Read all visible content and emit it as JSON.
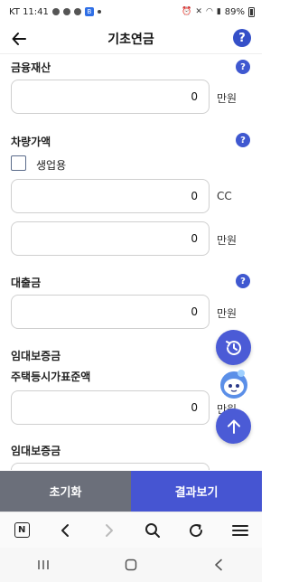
{
  "status_bar": {
    "carrier_time": "KT 11:41",
    "battery": "89%"
  },
  "header": {
    "title": "기초연금"
  },
  "form": {
    "financial_assets": {
      "label": "금융재산",
      "value": "0",
      "unit": "만원"
    },
    "vehicle": {
      "label": "차량가액",
      "business_use_label": "생업용",
      "business_use_checked": false,
      "displacement": {
        "value": "0",
        "unit": "CC"
      },
      "price": {
        "value": "0",
        "unit": "만원"
      }
    },
    "loan": {
      "label": "대출금",
      "value": "0",
      "unit": "만원"
    },
    "lease_deposit_1": {
      "label": "임대보증금",
      "sublabel": "주택등시가표준액",
      "value": "0",
      "unit": "만원"
    },
    "lease_deposit_2": {
      "label": "임대보증금"
    }
  },
  "help_symbol": "?",
  "actions": {
    "reset_label": "초기화",
    "result_label": "결과보기"
  },
  "browser": {
    "home_badge": "N"
  },
  "colors": {
    "accent": "#4655d2",
    "reset_button": "#6b6f7a"
  }
}
